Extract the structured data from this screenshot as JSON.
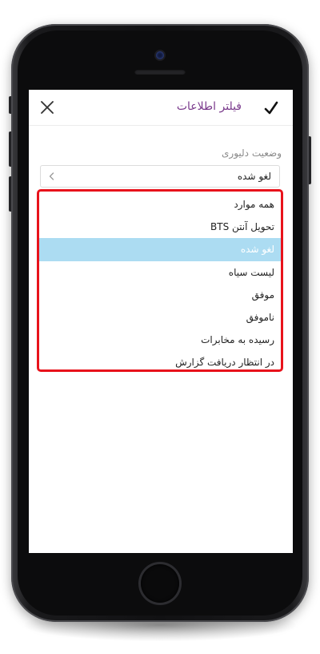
{
  "header": {
    "title": "فیلتر اطلاعات",
    "confirm_icon": "check-icon",
    "close_icon": "close-icon"
  },
  "filter": {
    "label": "وضعیت دلیوری",
    "selected_value": "لغو شده",
    "options": [
      "همه موارد",
      "تحویل آنتن BTS",
      "لغو شده",
      "لیست سیاه",
      "موفق",
      "ناموفق",
      "رسیده به مخابرات",
      "در انتظار دریافت گزارش"
    ],
    "selected_index": 2
  },
  "colors": {
    "title": "#7a3a8c",
    "highlight": "#acdcf2",
    "dropdown_border": "#e8121b",
    "label": "#8a8a8a"
  }
}
